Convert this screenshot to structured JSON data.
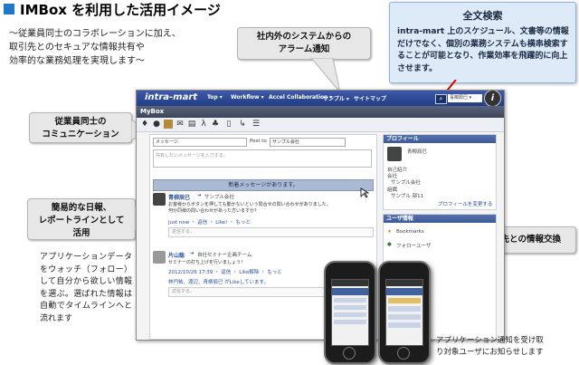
{
  "header": {
    "title": "IMBox を利用した活用イメージ",
    "intro": "～従業員同士のコラボレーションに加え、\n取引先とのセキュアな情報共有や\n効率的な業務処理を実現します～"
  },
  "callouts": {
    "alarm": "社内外のシステムからの\nアラーム通知",
    "search_title": "全文検索",
    "search_body": "intra-mart 上のスケジュール、文書等の情報だけでなく、個別の業務システムも横串検索することが可能となり、作業効率を飛躍的に向上させます。",
    "employee": "従業員同士の\nコミュニケーション",
    "report": "簡易的な日報、\nレポートラインとして\n活用",
    "customer": "顧客や取引先との情報交換"
  },
  "notes": {
    "left": "アプリケーションデータをウォッチ（フォロー）して自分から欲しい情報を選ぶ。選ばれた情報は自動でタイムラインへと流れます",
    "footer": "アプリケーション通知を受け取\nり対象ユーザにお知らせします"
  },
  "app": {
    "logo": "intra-mart",
    "nav": [
      "Top ▾",
      "Workflow ▾",
      "Accel Collaboration ▾",
      "サンプル ▾",
      "サイトマップ"
    ],
    "user_select": "青柳辰巳 ▾",
    "help": "i",
    "mybox": "MyBox",
    "toolbar_icons": [
      "bulb-icon",
      "person-icon",
      "cube-icon",
      "mail-icon",
      "book-icon",
      "person-walk-icon",
      "group-icon",
      "document-icon",
      "export-icon",
      "list-icon"
    ],
    "feed": {
      "type_select": "メッセージ",
      "post_to_label": "Post to",
      "post_to_select": "サンプル会社",
      "post_placeholder": "共有したいメッセージを入力する。",
      "new_messages": "新着メッセージがあります。",
      "posts": [
        {
          "user": "青柳辰巳",
          "target": "サンプル会社",
          "text1": "お客様からボタンを押しても動かないという問合せの問い合わせがありました。",
          "text2": "何か同様の問い合わせがあった方いますか？",
          "meta": "Just now ・ 返信 ・ Like! ・ もっと",
          "reply_placeholder": "返信する。"
        },
        {
          "user": "片山聡",
          "target": "自社セミナー企画チーム",
          "text1": "セミナーの打ち上げを行いましょう！",
          "meta": "2012/10/26 17:39 ・ 返信 ・ Like解除 ・ もっと",
          "likes": "林円祐、渡辺、青柳辰巳 がLikeしています。",
          "reply_placeholder": "返信する。"
        }
      ]
    },
    "profile": {
      "heading": "プロフィール",
      "name": "青柳辰巳",
      "self_intro_label": "自己紹介",
      "company_label": "会社",
      "company": "サンプル会社",
      "org_label": "組織",
      "org": "サンプル 部11",
      "edit_link": "プロフィールを変更する"
    },
    "user_info": {
      "heading": "ユーザ情報",
      "items": [
        "Bookmarks",
        "フォローユーザ"
      ]
    }
  }
}
